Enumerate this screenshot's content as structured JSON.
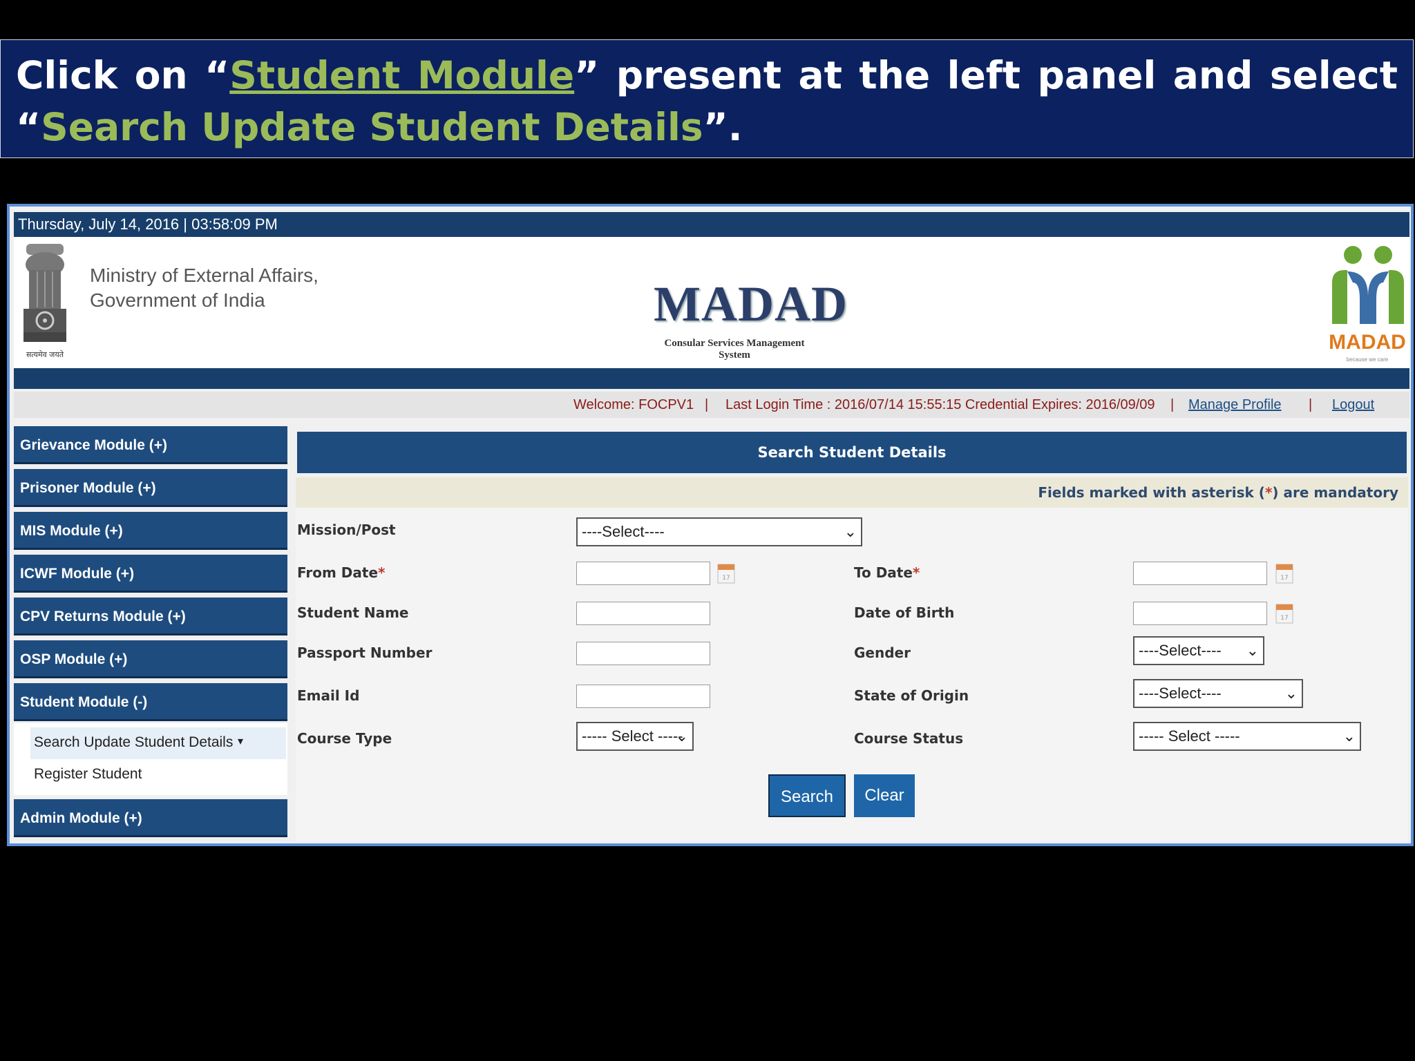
{
  "banner": {
    "t1": "Click on “",
    "t2": "Student Module",
    "t3": "” present at the left panel and select “",
    "t4": "Search Update Student Details",
    "t5": "”."
  },
  "topbar": {
    "datetime": "Thursday,  July  14, 2016 | 03:58:09 PM"
  },
  "header": {
    "ministry_line1": "Ministry of External Affairs,",
    "ministry_line2": "Government of India",
    "emblem_caption": "सत्यमेव जयते",
    "app_title": "MADAD",
    "app_subtitle": "Consular Services Management System",
    "logo_text": "MADAD",
    "logo_tagline": "because we care"
  },
  "welcome_bar": {
    "welcome": "Welcome: FOCPV1",
    "sep1": "|",
    "last_login": "Last Login Time : 2016/07/14 15:55:15 Credential Expires: 2016/09/09",
    "sep2": "|",
    "manage_profile": "Manage Profile",
    "sep3": "|",
    "logout": "Logout"
  },
  "sidebar": {
    "modules": [
      "Grievance Module (+)",
      "Prisoner Module (+)",
      "MIS Module (+)",
      "ICWF Module (+)",
      "CPV Returns Module (+)",
      "OSP Module (+)",
      "Student Module (-)",
      "Admin Module (+)"
    ],
    "submenu": [
      {
        "label": "Search Update Student Details",
        "arrow": "▾"
      },
      {
        "label": "Register Student"
      }
    ]
  },
  "main": {
    "title": "Search Student Details",
    "mandatory_pre": "Fields marked with asterisk (",
    "mandatory_ast": "*",
    "mandatory_post": ") are mandatory",
    "fields": {
      "mission": {
        "label": "Mission/Post",
        "value": "----Select----"
      },
      "from_date": {
        "label": "From Date",
        "asterisk": "*"
      },
      "to_date": {
        "label": "To Date",
        "asterisk": "*"
      },
      "student_name": {
        "label": "Student Name"
      },
      "dob": {
        "label": "Date of Birth"
      },
      "passport": {
        "label": "Passport Number"
      },
      "gender": {
        "label": "Gender",
        "value": "----Select----"
      },
      "email": {
        "label": "Email Id"
      },
      "state": {
        "label": "State of Origin",
        "value": "----Select----"
      },
      "course_type": {
        "label": "Course Type",
        "value": "----- Select -----"
      },
      "course_status": {
        "label": "Course Status",
        "value": "----- Select -----"
      }
    },
    "buttons": {
      "search": "Search",
      "clear": "Clear"
    }
  },
  "icons": [
    "calendar-icon",
    "chevron-down-icon",
    "dropdown-arrow-icon",
    "national-emblem-icon",
    "madad-logo-icon"
  ]
}
